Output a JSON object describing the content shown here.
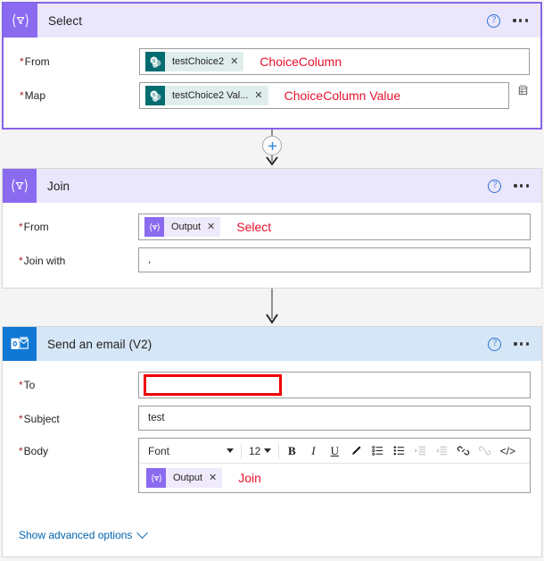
{
  "colors": {
    "select_accent": "#8a6bf0",
    "select_header": "#eae6fb",
    "outlook_accent": "#0f78d4",
    "outlook_header": "#d5e7f6",
    "sharepoint_token": "#036c70",
    "annotation_red": "#e8112d",
    "required_red": "#a4262c",
    "link_blue": "#0062ad",
    "canvas_bg": "#f4f4f4"
  },
  "cards": [
    {
      "id": "select",
      "title": "Select",
      "icon": "select-filter-icon",
      "icon_glyph": "{∇}",
      "help_label": "?",
      "menu_label": "•••",
      "selected": true,
      "rows": [
        {
          "label": "From",
          "required": true,
          "token": {
            "text": "testChoice2",
            "icon": "sharepoint-icon",
            "close": "✕"
          },
          "annotation": "ChoiceColumn"
        },
        {
          "label": "Map",
          "required": true,
          "token": {
            "text": "testChoice2 Val...",
            "icon": "sharepoint-icon",
            "close": "✕"
          },
          "annotation": "ChoiceColumn Value",
          "trailing_icon": "switch-to-text-mode-icon"
        }
      ]
    },
    {
      "id": "join",
      "title": "Join",
      "icon": "join-filter-icon",
      "icon_glyph": "{∇}",
      "help_label": "?",
      "menu_label": "•••",
      "selected": false,
      "rows": [
        {
          "label": "From",
          "required": true,
          "token": {
            "text": "Output",
            "icon": "select-output-icon",
            "close": "✕"
          },
          "annotation": "Select"
        },
        {
          "label": "Join with",
          "required": true,
          "value": ",",
          "annotation": ""
        }
      ]
    },
    {
      "id": "send-email",
      "title": "Send an email (V2)",
      "icon": "outlook-icon",
      "help_label": "?",
      "menu_label": "•••",
      "selected": false,
      "rows": [
        {
          "label": "To",
          "required": true,
          "redacted": true,
          "value": ""
        },
        {
          "label": "Subject",
          "required": true,
          "value": "test"
        },
        {
          "label": "Body",
          "required": true,
          "token": {
            "text": "Output",
            "icon": "select-output-icon",
            "close": "✕"
          },
          "annotation": "Join"
        }
      ]
    }
  ],
  "rte_toolbar": {
    "font_label": "Font",
    "size_label": "12",
    "buttons": [
      {
        "name": "bold-icon",
        "glyph": "B",
        "disabled": false
      },
      {
        "name": "italic-icon",
        "glyph": "I",
        "disabled": false
      },
      {
        "name": "underline-icon",
        "glyph": "U",
        "disabled": false
      },
      {
        "name": "text-color-pen-icon",
        "glyph": "✎",
        "disabled": false
      },
      {
        "name": "bulleted-list-icon",
        "glyph": "☷",
        "disabled": false
      },
      {
        "name": "numbered-list-icon",
        "glyph": "≔",
        "disabled": false
      },
      {
        "name": "indent-icon",
        "glyph": "⇥",
        "disabled": true
      },
      {
        "name": "outdent-icon",
        "glyph": "⇤",
        "disabled": true
      },
      {
        "name": "link-icon",
        "glyph": "🔗",
        "disabled": false
      },
      {
        "name": "unlink-icon",
        "glyph": "⛓",
        "disabled": true
      },
      {
        "name": "code-view-icon",
        "glyph": "</>",
        "disabled": false
      }
    ]
  },
  "connectors": [
    {
      "id": "select-to-join",
      "has_plus_button": true,
      "plus_label": "+"
    },
    {
      "id": "join-to-email",
      "has_plus_button": false
    }
  ],
  "advanced_options": {
    "label": "Show advanced options",
    "icon": "chevron-down-icon"
  }
}
